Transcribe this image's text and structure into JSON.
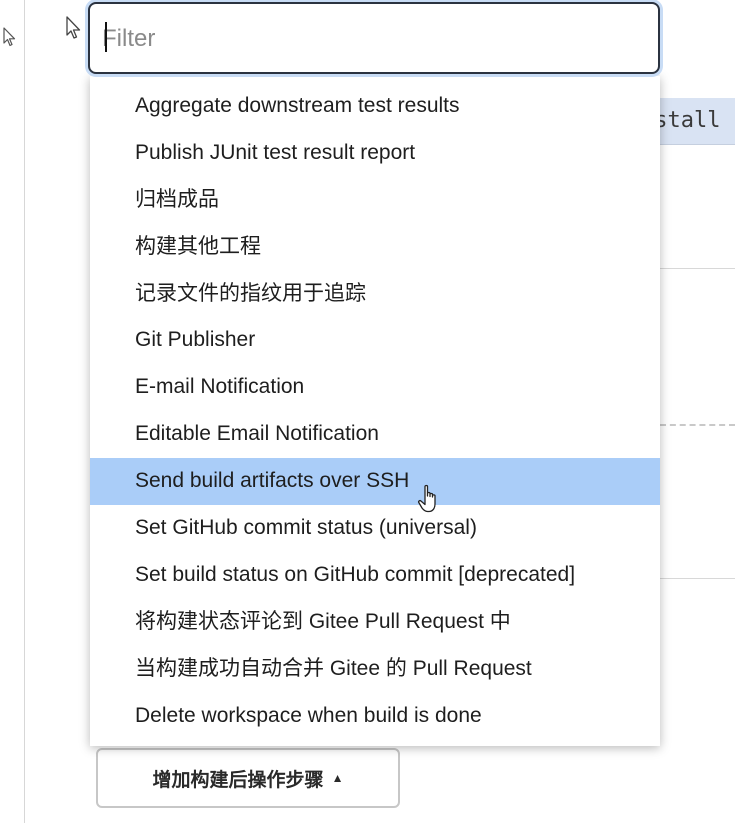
{
  "filter": {
    "placeholder": "Filter",
    "value": ""
  },
  "background": {
    "code_snippet": "nstall"
  },
  "dropdown": {
    "selected_index": 8,
    "items": [
      {
        "label": "Aggregate downstream test results"
      },
      {
        "label": "Publish JUnit test result report"
      },
      {
        "label": "归档成品"
      },
      {
        "label": "构建其他工程"
      },
      {
        "label": "记录文件的指纹用于追踪"
      },
      {
        "label": "Git Publisher"
      },
      {
        "label": "E-mail Notification"
      },
      {
        "label": "Editable Email Notification"
      },
      {
        "label": "Send build artifacts over SSH"
      },
      {
        "label": "Set GitHub commit status (universal)"
      },
      {
        "label": "Set build status on GitHub commit [deprecated]"
      },
      {
        "label": "将构建状态评论到 Gitee Pull Request 中"
      },
      {
        "label": "当构建成功自动合并 Gitee 的 Pull Request"
      },
      {
        "label": "Delete workspace when build is done"
      }
    ]
  },
  "add_step_button": {
    "label": "增加构建后操作步骤",
    "icon": "caret-up-icon"
  },
  "colors": {
    "highlight": "#aacdf8",
    "focus_ring": "#c8dcf5",
    "code_strip": "#d9e3f3"
  }
}
